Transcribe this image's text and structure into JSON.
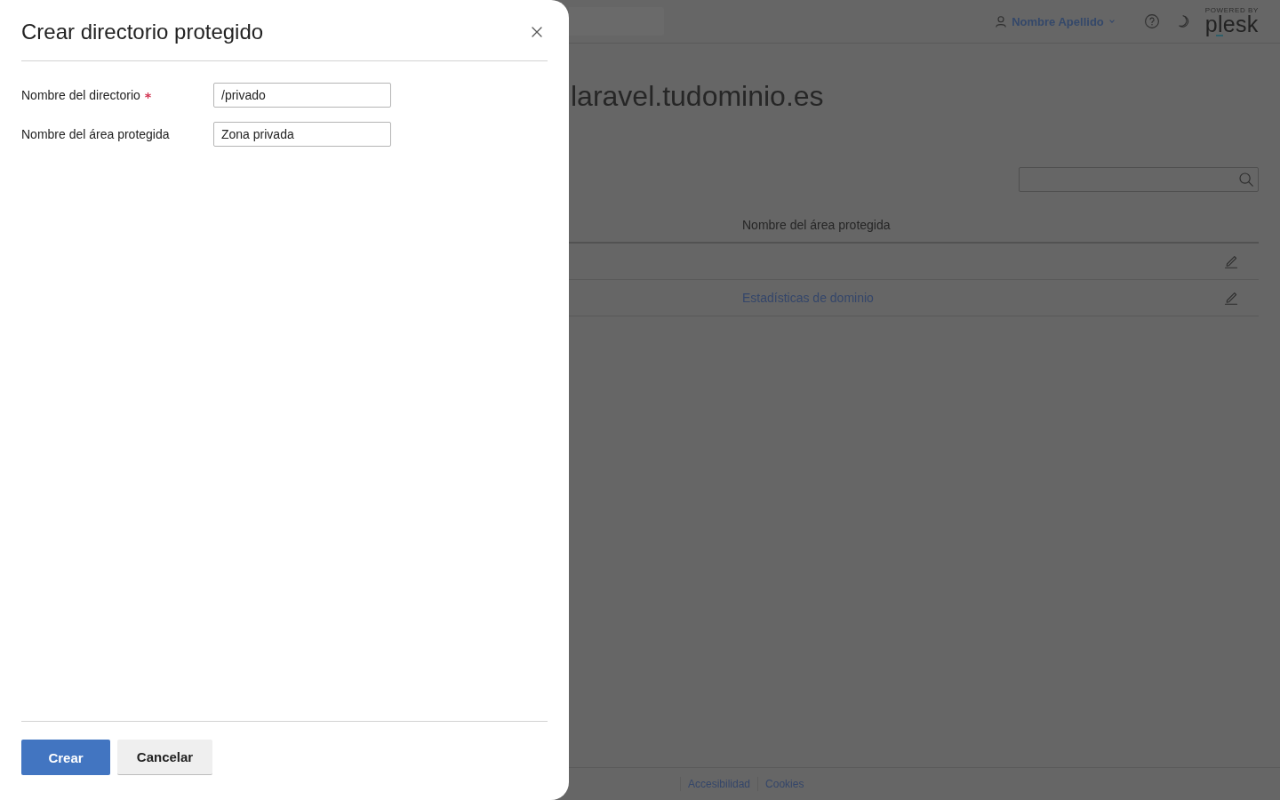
{
  "dialog": {
    "title": "Crear directorio protegido",
    "fields": [
      {
        "label": "Nombre del directorio",
        "required": true,
        "value": "/privado"
      },
      {
        "label": "Nombre del área protegida",
        "required": false,
        "value": "Zona privada"
      }
    ],
    "buttons": [
      {
        "label": "Crear",
        "kind": "primary"
      },
      {
        "label": "Cancelar",
        "kind": "secondary"
      }
    ]
  },
  "header": {
    "user": "Nombre Apellido",
    "logo": {
      "tagline": "POWERED BY",
      "name": "plesk"
    }
  },
  "page": {
    "title": "laravel.tudominio.es",
    "table": {
      "columns": [
        "Nombre del área protegida"
      ],
      "rows": [
        {},
        {
          "area_name": "Estadísticas de dominio"
        }
      ]
    }
  },
  "footer": {
    "links": [
      "Accesibilidad",
      "Cookies"
    ]
  }
}
